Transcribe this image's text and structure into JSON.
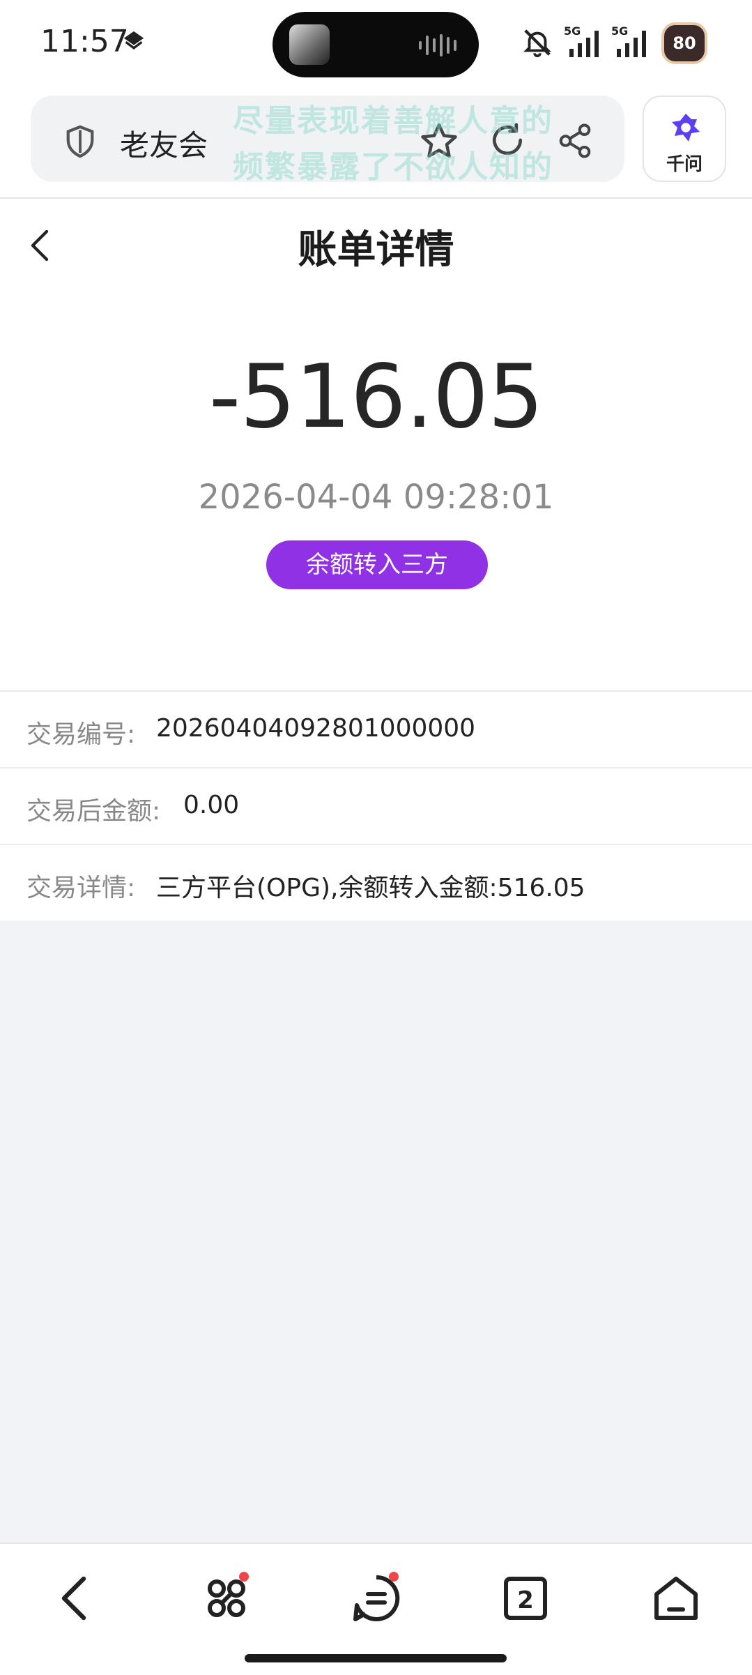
{
  "status_bar": {
    "time": "11:57",
    "network_1": "5G",
    "network_2": "5G",
    "battery": "80"
  },
  "browser": {
    "site_name": "老友会",
    "watermark_line1": "尽量表现着善解人意的",
    "watermark_line2": "频繁暴露了不欲人知的",
    "ai_label": "千问"
  },
  "page": {
    "title": "账单详情"
  },
  "summary": {
    "amount": "-516.05",
    "datetime": "2026-04-04 09:28:01",
    "tag": "余额转入三方"
  },
  "details": [
    {
      "label": "交易编号:",
      "value": "20260404092801000000"
    },
    {
      "label": "交易后金额:",
      "value": "0.00"
    },
    {
      "label": "交易详情:",
      "value": "三方平台(OPG),余额转入金额:516.05"
    }
  ],
  "bottom_nav": {
    "tab_count": "2"
  },
  "colors": {
    "accent": "#9131e6",
    "page_bg": "#f2f3f7",
    "badge": "#f0464a"
  }
}
